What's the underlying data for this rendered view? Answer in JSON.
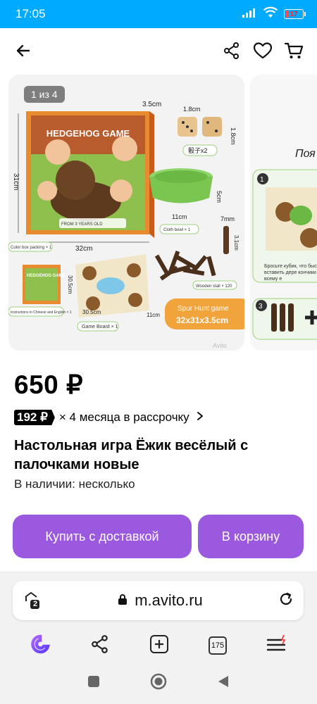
{
  "status_bar": {
    "time": "17:05",
    "battery": "17",
    "battery_level": 0.17,
    "icons": [
      "signal-icon",
      "wifi-icon",
      "battery-icon"
    ]
  },
  "header": {
    "icons": [
      "back-arrow-icon",
      "share-icon",
      "heart-icon",
      "cart-icon"
    ]
  },
  "gallery": {
    "counter": "1 из 4",
    "photo_main": {
      "product_title": "HEDGEHOG GAME",
      "dim_box_side": "3.5cm",
      "dim_dice_width": "1.8cm",
      "dim_dice_height": "1.8cm",
      "dice_label": "骰子x2",
      "dim_box_height": "31cm",
      "dim_bowl": "5cm",
      "dim_bowl_width": "11cm",
      "bowl_label": "Cloth bowl × 1",
      "dim_stick_top": "7mm",
      "dim_stick_height": "3.1cm",
      "dim_box_width": "32cm",
      "box_label": "Color box packing × 1",
      "board_dim_side": "30.5cm",
      "board_dim_bottom": "30.5cm",
      "board_dim_right": "11cm",
      "sticks_label": "Wooden stall × 120",
      "manual_label": "Instructions in Chinese and English × 1",
      "board_label": "Game Board × 1",
      "spur_title": "Spur Hunt game",
      "spur_size": "32x31x3.5cm",
      "watermark": "Avito",
      "age_badge": "FROM 3 YEARS OLD"
    },
    "photo_next": {
      "heading": "Поя",
      "step1": "1",
      "text": "Бросьте кубик, что быстро вставить дере кончики по всему е",
      "step3": "3"
    }
  },
  "product": {
    "price": "650 ₽",
    "installment_amount": "192 ₽",
    "installment_text": "× 4 месяца в рассрочку",
    "title": "Настольная игра Ёжик весёлый с палочками новые",
    "availability": "В наличии: несколько"
  },
  "actions": {
    "buy_label": "Купить с доставкой",
    "cart_label": "В корзину",
    "button_color": "#9b59e0"
  },
  "browser": {
    "url": "m.avito.ru",
    "shield_badge": "2",
    "tabs_count": "175"
  },
  "colors": {
    "status_bar": "#00aaff",
    "accent": "#9b59e0"
  }
}
